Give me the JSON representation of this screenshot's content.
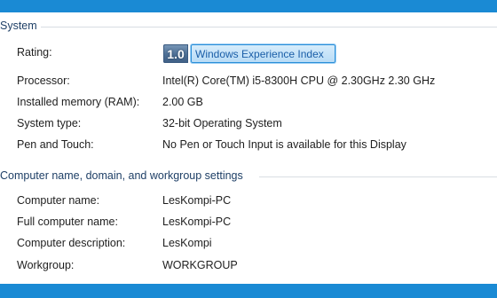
{
  "system": {
    "title": "System",
    "rating_label": "Rating:",
    "rating_score": "1.0",
    "rating_link": "Windows Experience Index",
    "rows": [
      {
        "label": "Processor:",
        "value": "Intel(R) Core(TM) i5-8300H CPU @ 2.30GHz   2.30 GHz"
      },
      {
        "label": "Installed memory (RAM):",
        "value": "2.00 GB"
      },
      {
        "label": "System type:",
        "value": "32-bit Operating System"
      },
      {
        "label": "Pen and Touch:",
        "value": "No Pen or Touch Input is available for this Display"
      }
    ]
  },
  "computer_name": {
    "title": "Computer name, domain, and workgroup settings",
    "rows": [
      {
        "label": "Computer name:",
        "value": "LesKompi-PC"
      },
      {
        "label": "Full computer name:",
        "value": "LesKompi-PC"
      },
      {
        "label": "Computer description:",
        "value": "LesKompi"
      },
      {
        "label": "Workgroup:",
        "value": "WORKGROUP"
      }
    ]
  },
  "colors": {
    "frame": "#1a8ad4",
    "section_title": "#1e3f66",
    "link": "#1a5ea8"
  }
}
